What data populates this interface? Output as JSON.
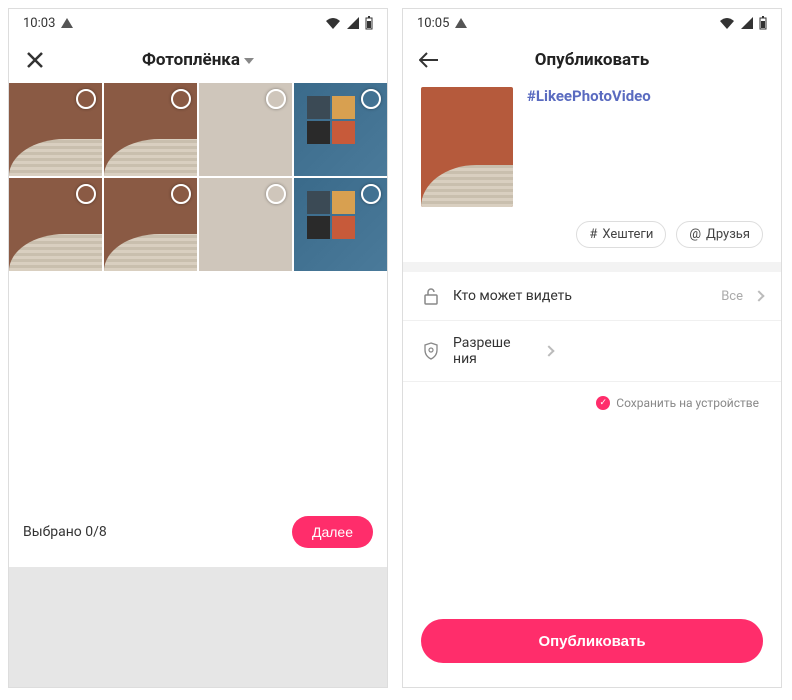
{
  "screen1": {
    "status_time": "10:03",
    "title": "Фотоплёнка",
    "selected_text": "Выбрано 0/8",
    "next_btn": "Далее"
  },
  "screen2": {
    "status_time": "10:05",
    "title": "Опубликовать",
    "hashtag_text": "#LikeePhotoVideo",
    "chip_hashtags": "Хештеги",
    "chip_friends": "Друзья",
    "row_privacy_label": "Кто может видеть",
    "row_privacy_value": "Все",
    "row_perm_label": "Разреше\nния",
    "save_device": "Сохранить на устройстве",
    "publish_btn": "Опубликовать"
  }
}
